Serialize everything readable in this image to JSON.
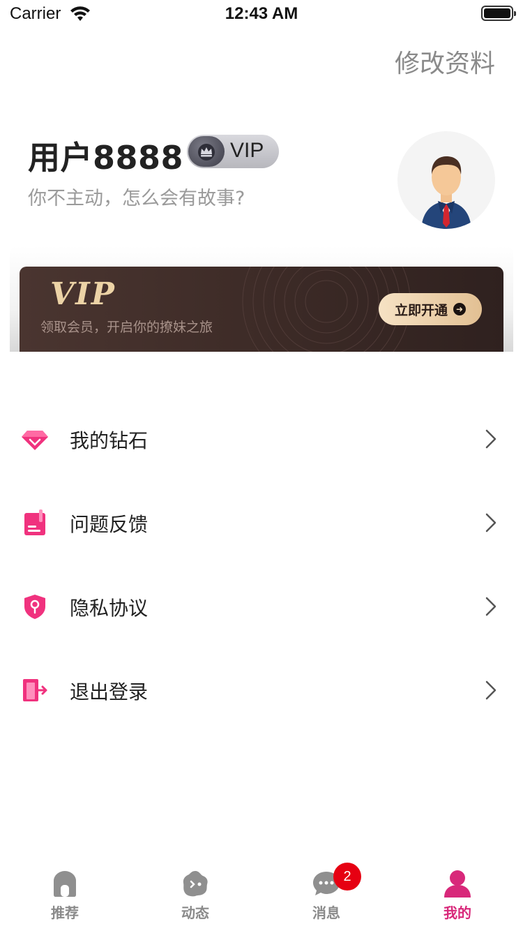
{
  "status_bar": {
    "carrier": "Carrier",
    "time": "12:43 AM"
  },
  "header": {
    "edit_label": "修改资料"
  },
  "profile": {
    "username": "用户8888",
    "vip_badge": "VIP",
    "motto": "你不主动，怎么会有故事?"
  },
  "vip_banner": {
    "title": "VIP",
    "subtitle": "领取会员，开启你的撩妹之旅",
    "button_label": "立即开通"
  },
  "menu": {
    "items": [
      {
        "label": "我的钻石",
        "icon": "diamond-icon"
      },
      {
        "label": "问题反馈",
        "icon": "feedback-book-icon"
      },
      {
        "label": "隐私协议",
        "icon": "privacy-shield-icon"
      },
      {
        "label": "退出登录",
        "icon": "logout-door-icon"
      }
    ]
  },
  "tab_bar": {
    "tabs": [
      {
        "label": "推荐",
        "icon": "home-icon"
      },
      {
        "label": "动态",
        "icon": "moments-icon"
      },
      {
        "label": "消息",
        "icon": "message-icon",
        "badge": "2"
      },
      {
        "label": "我的",
        "icon": "profile-icon",
        "active": true
      }
    ]
  },
  "colors": {
    "accent": "#d8287a",
    "menu_icon": "#f0327e",
    "badge": "#e60012",
    "vip_gold": "#ecd3a6"
  }
}
